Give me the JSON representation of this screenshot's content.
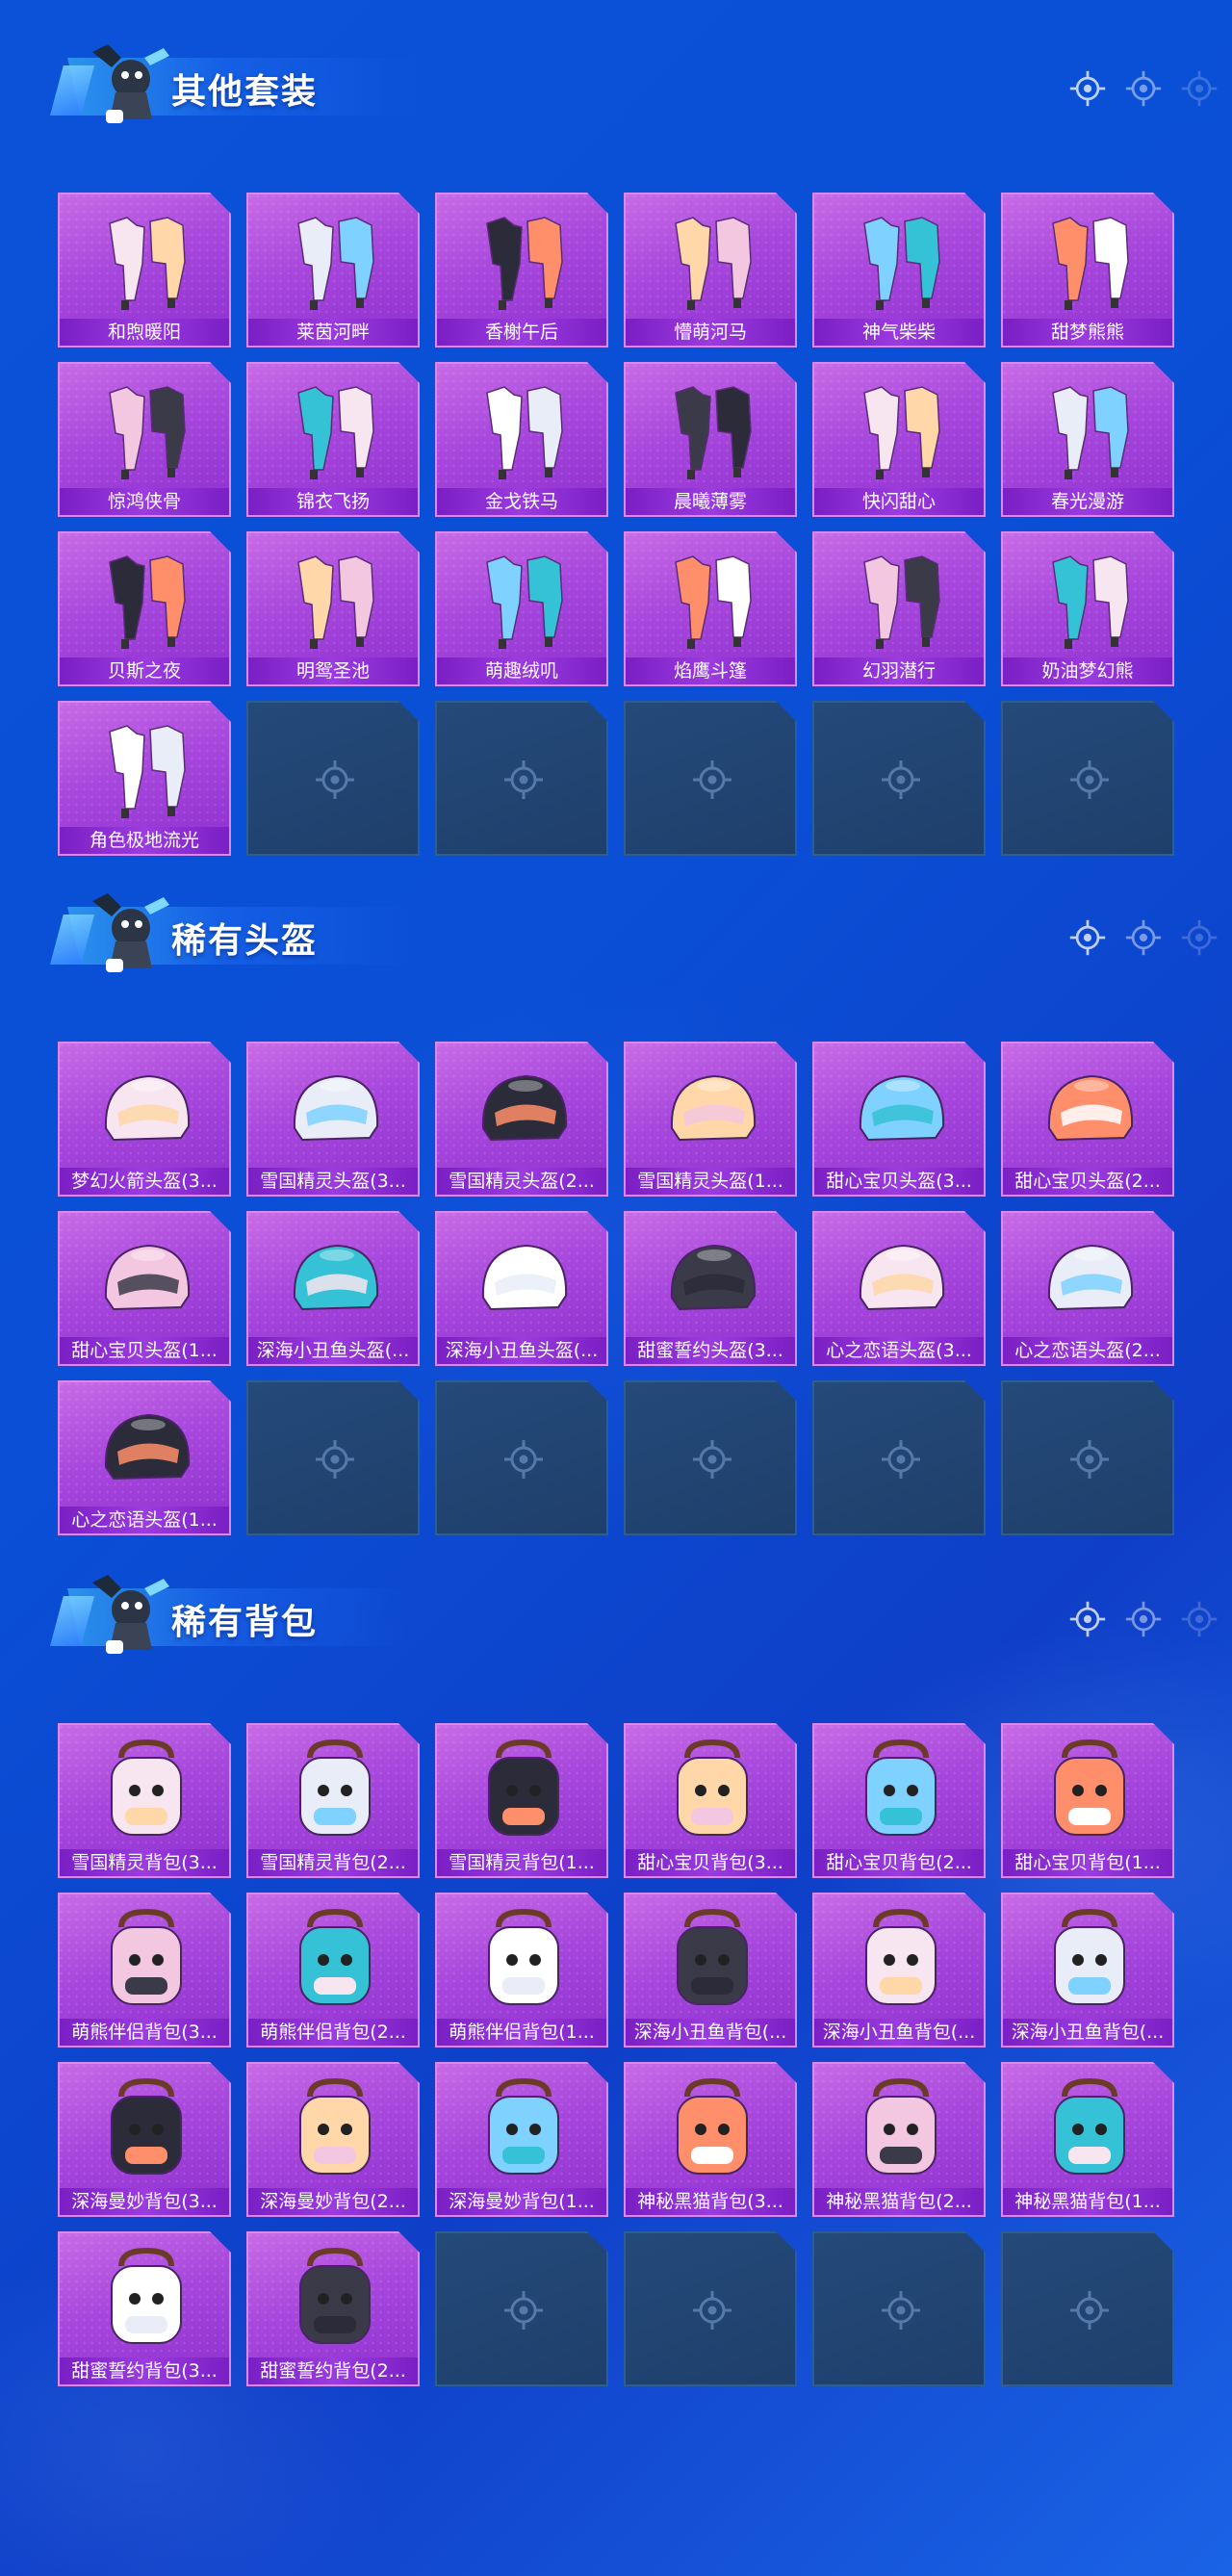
{
  "colors": {
    "background": "#0b52d8",
    "card_filled": "#a747dd",
    "card_label_bar": "#7a1fc4",
    "card_empty": "#213f6d",
    "title_text": "#ffffff"
  },
  "sections": [
    {
      "title": "其他套装",
      "icon": "outfit-icon",
      "items": [
        "和煦暖阳",
        "莱茵河畔",
        "香榭午后",
        "懵萌河马",
        "神气柴柴",
        "甜梦熊熊",
        "惊鸿侠骨",
        "锦衣飞扬",
        "金戈铁马",
        "晨曦薄雾",
        "快闪甜心",
        "春光漫游",
        "贝斯之夜",
        "明鸳圣池",
        "萌趣绒叽",
        "焰鹰斗篷",
        "幻羽潜行",
        "奶油梦幻熊",
        "角色极地流光"
      ],
      "empty_slots": 5
    },
    {
      "title": "稀有头盔",
      "icon": "helmet-icon",
      "items": [
        "梦幻火箭头盔(3...",
        "雪国精灵头盔(3...",
        "雪国精灵头盔(2...",
        "雪国精灵头盔(1...",
        "甜心宝贝头盔(3...",
        "甜心宝贝头盔(2...",
        "甜心宝贝头盔(1...",
        "深海小丑鱼头盔(...",
        "深海小丑鱼头盔(...",
        "甜蜜誓约头盔(3...",
        "心之恋语头盔(3...",
        "心之恋语头盔(2...",
        "心之恋语头盔(1..."
      ],
      "empty_slots": 5
    },
    {
      "title": "稀有背包",
      "icon": "backpack-icon",
      "items": [
        "雪国精灵背包(3...",
        "雪国精灵背包(2...",
        "雪国精灵背包(1...",
        "甜心宝贝背包(3...",
        "甜心宝贝背包(2...",
        "甜心宝贝背包(1...",
        "萌熊伴侣背包(3...",
        "萌熊伴侣背包(2...",
        "萌熊伴侣背包(1...",
        "深海小丑鱼背包(...",
        "深海小丑鱼背包(...",
        "深海小丑鱼背包(...",
        "深海曼妙背包(3...",
        "深海曼妙背包(2...",
        "深海曼妙背包(1...",
        "神秘黑猫背包(3...",
        "神秘黑猫背包(2...",
        "神秘黑猫背包(1...",
        "甜蜜誓约背包(3...",
        "甜蜜誓约背包(2..."
      ],
      "empty_slots": 4
    }
  ]
}
